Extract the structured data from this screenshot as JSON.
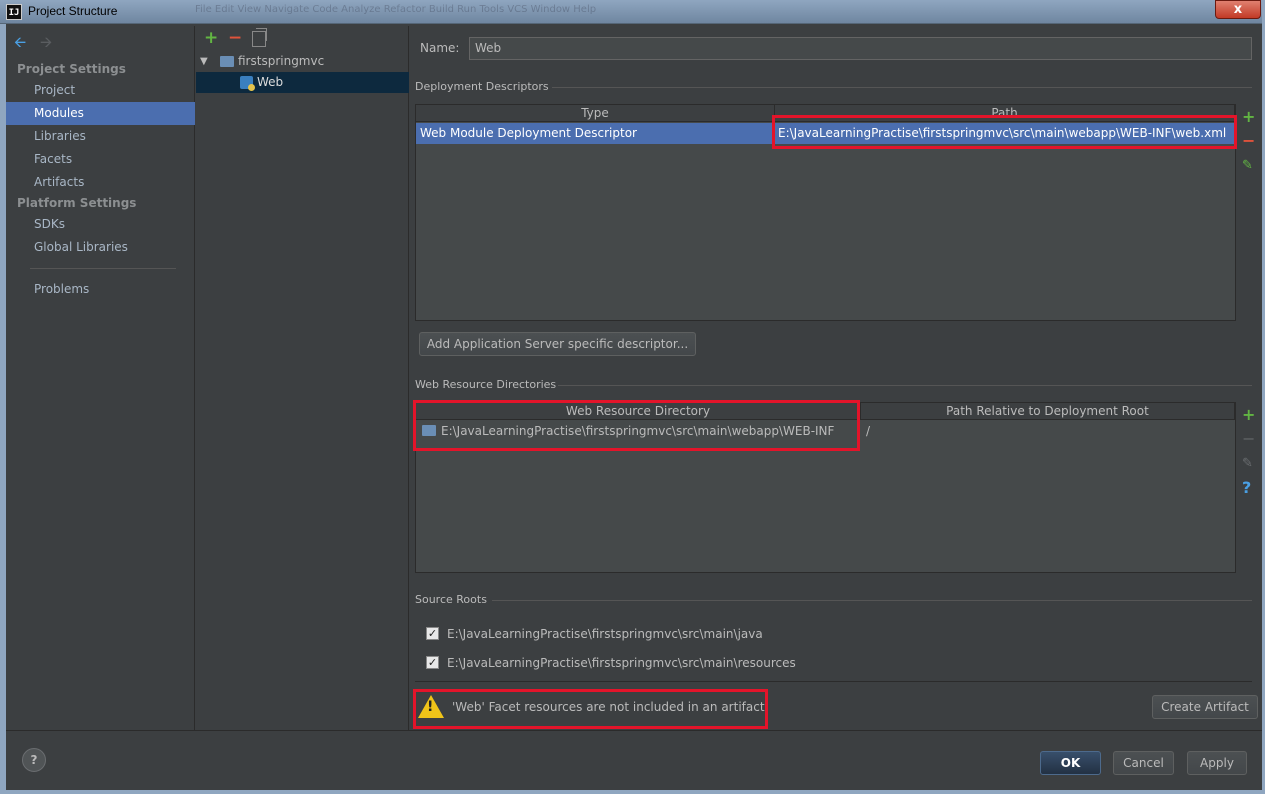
{
  "window": {
    "title": "Project Structure",
    "app_icon_text": "IJ",
    "close_label": "x",
    "background_menu": "File  Edit  View  Navigate  Code  Analyze  Refactor  Build  Run  Tools  VCS  Window  Help"
  },
  "sidebar": {
    "back_icon": "arrow-left-icon",
    "forward_icon": "arrow-right-icon",
    "sections": [
      {
        "title": "Project Settings",
        "items": [
          "Project",
          "Modules",
          "Libraries",
          "Facets",
          "Artifacts"
        ]
      },
      {
        "title": "Platform Settings",
        "items": [
          "SDKs",
          "Global Libraries"
        ]
      }
    ],
    "problems": "Problems",
    "selected": "Modules"
  },
  "tree": {
    "toolbar": {
      "add": "+",
      "remove": "−"
    },
    "root": "firstspringmvc",
    "child": "Web"
  },
  "main": {
    "name_label": "Name:",
    "name_value": "Web",
    "deployment": {
      "title": "Deployment Descriptors",
      "columns": [
        "Type",
        "Path"
      ],
      "rows": [
        {
          "type": "Web Module Deployment Descriptor",
          "path": "E:\\JavaLearningPractise\\firstspringmvc\\src\\main\\webapp\\WEB-INF\\web.xml"
        }
      ],
      "add_server_button": "Add Application Server specific descriptor..."
    },
    "web_resources": {
      "title": "Web Resource Directories",
      "columns": [
        "Web Resource Directory",
        "Path Relative to Deployment Root"
      ],
      "rows": [
        {
          "dir": "E:\\JavaLearningPractise\\firstspringmvc\\src\\main\\webapp\\WEB-INF",
          "rel": "/"
        }
      ],
      "help": "?"
    },
    "source_roots": {
      "title": "Source Roots",
      "items": [
        {
          "checked": true,
          "path": "E:\\JavaLearningPractise\\firstspringmvc\\src\\main\\java"
        },
        {
          "checked": true,
          "path": "E:\\JavaLearningPractise\\firstspringmvc\\src\\main\\resources"
        }
      ]
    },
    "warning": {
      "text": "'Web' Facet resources are not included in an artifact",
      "mark": "!",
      "create_button": "Create Artifact"
    }
  },
  "footer": {
    "help": "?",
    "ok": "OK",
    "cancel": "Cancel",
    "apply": "Apply"
  },
  "colors": {
    "selection": "#4b6eaf",
    "highlight_box": "#e3142a",
    "panel_bg": "#3c3f41",
    "add_green": "#62b543",
    "remove_red": "#e0533b"
  }
}
